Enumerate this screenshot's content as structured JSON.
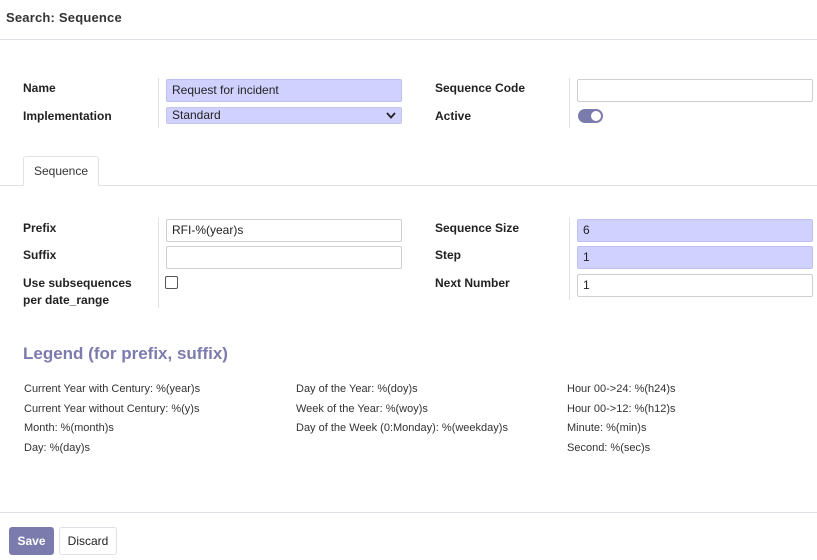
{
  "header": {
    "title": "Search: Sequence"
  },
  "form": {
    "name_label": "Name",
    "name_value": "Request for incident",
    "implementation_label": "Implementation",
    "implementation_value": "Standard",
    "sequence_code_label": "Sequence Code",
    "sequence_code_value": "",
    "active_label": "Active",
    "active_value": true
  },
  "tabs": [
    {
      "label": "Sequence",
      "active": true
    }
  ],
  "sequence_tab": {
    "prefix_label": "Prefix",
    "prefix_value": "RFI-%(year)s",
    "suffix_label": "Suffix",
    "suffix_value": "",
    "subseq_label_line1": "Use subsequences",
    "subseq_label_line2": "per date_range",
    "subseq_checked": false,
    "size_label": "Sequence Size",
    "size_value": "6",
    "step_label": "Step",
    "step_value": "1",
    "next_label": "Next Number",
    "next_value": "1"
  },
  "legend": {
    "title": "Legend (for prefix, suffix)",
    "col1": [
      "Current Year with Century: %(year)s",
      "Current Year without Century: %(y)s",
      "Month: %(month)s",
      "Day: %(day)s"
    ],
    "col2": [
      "Day of the Year: %(doy)s",
      "Week of the Year: %(woy)s",
      "Day of the Week (0:Monday): %(weekday)s"
    ],
    "col3": [
      "Hour 00->24: %(h24)s",
      "Hour 00->12: %(h12)s",
      "Minute: %(min)s",
      "Second: %(sec)s"
    ]
  },
  "footer": {
    "save_label": "Save",
    "discard_label": "Discard"
  },
  "colors": {
    "accent": "#7c7bad",
    "required_field": "#d1d1ff",
    "border": "#dee2e6"
  },
  "icons": {
    "implementation_dropdown": "chevron-down-icon"
  }
}
